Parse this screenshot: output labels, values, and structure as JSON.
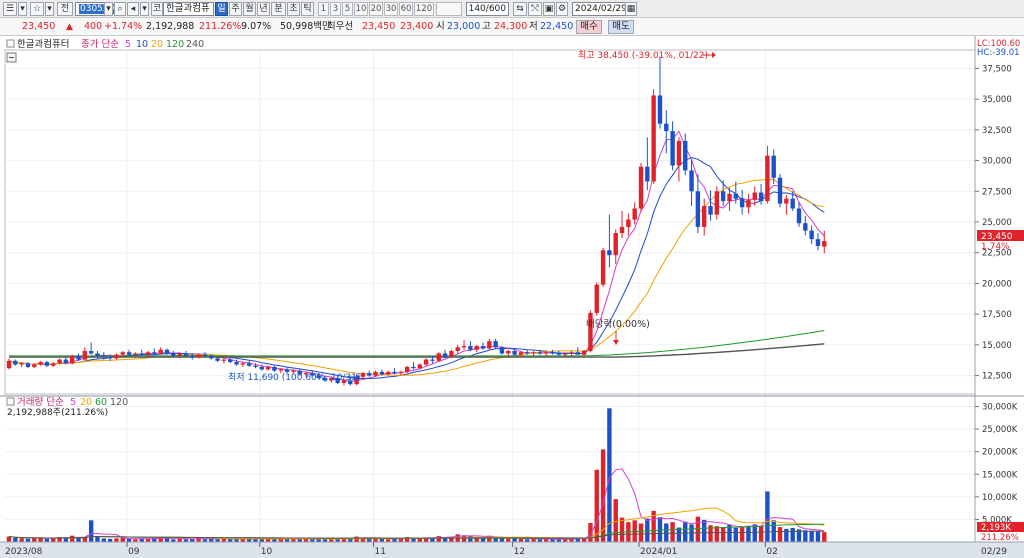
{
  "toolbar": {
    "menu_icon": "menu-icon",
    "star_icon": "star-icon",
    "market_label": "전",
    "stock_code": "030520",
    "stock_name": "한글과컴퓨",
    "prefix_label": "코",
    "periods": [
      "일",
      "주",
      "월",
      "년",
      "분",
      "초",
      "틱"
    ],
    "active_period": "일",
    "numbers": [
      "1",
      "3",
      "5",
      "10",
      "20",
      "30",
      "60",
      "120"
    ],
    "count": "140/600",
    "date": "2024/02/29"
  },
  "quote": {
    "price": "23,450",
    "change": "400",
    "change_rate": "+1.74%",
    "volume": "2,192,988",
    "volume_ratio": "211.26%",
    "turnover": "9.07%",
    "amount": "50,998백만",
    "pref_label": "최우선",
    "ask": "23,450",
    "bid": "23,400",
    "open_label": "시",
    "open": "23,000",
    "high_label": "고",
    "high": "24,300",
    "low_label": "저",
    "low": "22,450",
    "buy_label": "매수",
    "sell_label": "매도"
  },
  "price_panel": {
    "legend_name": "한글과컴퓨터",
    "ma_label": "종가 단순",
    "ma_periods": [
      "5",
      "10",
      "20",
      "120",
      "240"
    ],
    "ma_colors": [
      "#d23fd0",
      "#2248c9",
      "#f0a400",
      "#1e9a2e",
      "#555555"
    ],
    "lc_label": "LC:100.60",
    "hc_label": "HC:-39.01",
    "price_ticks": [
      "37,500",
      "35,000",
      "32,500",
      "30,000",
      "27,500",
      "25,000",
      "22,500",
      "20,000",
      "17,500",
      "15,000",
      "12,500"
    ],
    "current_price_label": "23,450",
    "current_rate_label": "1.74%",
    "high_annotation": "최고 38,450 (-39.01%, 01/22)",
    "low_annotation": "최저 11,690 (100.60%, 10/31)",
    "dividend_annotation": "배당락(0.00%)"
  },
  "volume_panel": {
    "legend_label": "거래량 단순",
    "ma_periods": [
      "5",
      "20",
      "60",
      "120"
    ],
    "ma_colors": [
      "#d23fd0",
      "#f0a400",
      "#1e9a2e",
      "#555555"
    ],
    "volume_info": "2,192,988주(211.26%)",
    "volume_ticks": [
      "30,000K",
      "25,000K",
      "20,000K",
      "15,000K",
      "10,000K",
      "5,000K"
    ],
    "current_volume_label": "2,193K",
    "current_ratio_label": "211.26%"
  },
  "date_axis": [
    "2023/08",
    "09",
    "10",
    "11",
    "12",
    "2024/01",
    "02",
    "02/29"
  ],
  "colors": {
    "up": "#e0232b",
    "down": "#1c52c9",
    "axis_bg": "#dde3ec",
    "active_tab": "#2d69c6"
  },
  "chart_data": {
    "type": "candlestick",
    "price_range": [
      11000,
      39000
    ],
    "volume_range": [
      0,
      31000
    ],
    "candles": [
      [
        13100,
        13900,
        13000,
        13700
      ],
      [
        13700,
        13800,
        13300,
        13400
      ],
      [
        13400,
        13600,
        13200,
        13500
      ],
      [
        13500,
        13600,
        13100,
        13200
      ],
      [
        13200,
        13500,
        13100,
        13400
      ],
      [
        13400,
        13700,
        13300,
        13600
      ],
      [
        13600,
        13700,
        13200,
        13300
      ],
      [
        13300,
        13600,
        13200,
        13500
      ],
      [
        13500,
        13900,
        13400,
        13800
      ],
      [
        13800,
        14000,
        13400,
        13500
      ],
      [
        13500,
        14200,
        13400,
        14100
      ],
      [
        14100,
        14300,
        13700,
        13800
      ],
      [
        13800,
        14800,
        13700,
        14500
      ],
      [
        14500,
        15200,
        14200,
        14300
      ],
      [
        14300,
        14500,
        13900,
        14100
      ],
      [
        14100,
        14400,
        13800,
        14000
      ],
      [
        14000,
        14200,
        13700,
        13900
      ],
      [
        13900,
        14300,
        13800,
        14200
      ],
      [
        14200,
        14500,
        14000,
        14400
      ],
      [
        14400,
        14600,
        14100,
        14200
      ],
      [
        14200,
        14400,
        14000,
        14300
      ],
      [
        14300,
        14600,
        14100,
        14200
      ],
      [
        14200,
        14500,
        14000,
        14400
      ],
      [
        14400,
        14700,
        14200,
        14300
      ],
      [
        14300,
        14800,
        14200,
        14600
      ],
      [
        14600,
        14700,
        14200,
        14300
      ],
      [
        14300,
        14500,
        14000,
        14100
      ],
      [
        14100,
        14400,
        13900,
        14300
      ],
      [
        14300,
        14500,
        14000,
        14100
      ],
      [
        14100,
        14300,
        13800,
        14000
      ],
      [
        14000,
        14300,
        13900,
        14200
      ],
      [
        14200,
        14400,
        14000,
        14100
      ],
      [
        14100,
        14200,
        13800,
        13900
      ],
      [
        13900,
        14100,
        13600,
        13700
      ],
      [
        13700,
        13900,
        13500,
        13800
      ],
      [
        13800,
        14000,
        13500,
        13600
      ],
      [
        13600,
        13800,
        13300,
        13400
      ],
      [
        13400,
        13600,
        13200,
        13500
      ],
      [
        13500,
        13700,
        13200,
        13300
      ],
      [
        13300,
        13500,
        13100,
        13200
      ],
      [
        13200,
        13400,
        12900,
        13000
      ],
      [
        13000,
        13300,
        12900,
        13200
      ],
      [
        13200,
        13300,
        12800,
        12900
      ],
      [
        12900,
        13100,
        12700,
        13000
      ],
      [
        13000,
        13200,
        12700,
        12800
      ],
      [
        12800,
        13000,
        12600,
        12900
      ],
      [
        12900,
        13000,
        12500,
        12600
      ],
      [
        12600,
        12800,
        12400,
        12700
      ],
      [
        12700,
        12900,
        12400,
        12500
      ],
      [
        12500,
        12700,
        12200,
        12300
      ],
      [
        12300,
        12500,
        12000,
        12100
      ],
      [
        12100,
        12400,
        11900,
        12300
      ],
      [
        12300,
        12500,
        11800,
        11900
      ],
      [
        11900,
        12200,
        11700,
        12100
      ],
      [
        12100,
        12400,
        11690,
        11800
      ],
      [
        11800,
        12500,
        11700,
        12400
      ],
      [
        12400,
        12800,
        12300,
        12700
      ],
      [
        12700,
        12900,
        12400,
        12500
      ],
      [
        12500,
        12900,
        12400,
        12800
      ],
      [
        12800,
        13000,
        12500,
        12600
      ],
      [
        12600,
        12900,
        12500,
        12800
      ],
      [
        12800,
        13100,
        12600,
        12700
      ],
      [
        12700,
        12900,
        12500,
        12800
      ],
      [
        12800,
        13300,
        12700,
        13200
      ],
      [
        13200,
        13600,
        13000,
        13100
      ],
      [
        13100,
        13500,
        13000,
        13400
      ],
      [
        13400,
        13900,
        13300,
        13800
      ],
      [
        13800,
        14100,
        13500,
        13700
      ],
      [
        13700,
        14400,
        13600,
        14300
      ],
      [
        14300,
        14600,
        13900,
        14000
      ],
      [
        14000,
        14600,
        13900,
        14500
      ],
      [
        14500,
        15000,
        14300,
        14800
      ],
      [
        14800,
        15400,
        14600,
        14900
      ],
      [
        14900,
        15300,
        14500,
        14600
      ],
      [
        14600,
        15000,
        14400,
        14900
      ],
      [
        14900,
        15200,
        14600,
        14700
      ],
      [
        14700,
        15500,
        14600,
        15300
      ],
      [
        15300,
        15500,
        14700,
        14800
      ],
      [
        14800,
        14900,
        14200,
        14300
      ],
      [
        14300,
        14600,
        14100,
        14500
      ],
      [
        14500,
        14700,
        14100,
        14200
      ],
      [
        14200,
        14500,
        14000,
        14400
      ],
      [
        14400,
        14600,
        14200,
        14300
      ],
      [
        14300,
        14500,
        14100,
        14400
      ],
      [
        14400,
        14600,
        14200,
        14300
      ],
      [
        14300,
        14500,
        14100,
        14400
      ],
      [
        14400,
        14600,
        14200,
        14300
      ],
      [
        14300,
        14500,
        14100,
        14200
      ],
      [
        14200,
        14400,
        14000,
        14300
      ],
      [
        14300,
        14500,
        14100,
        14400
      ],
      [
        14400,
        14800,
        14300,
        14200
      ],
      [
        14200,
        14600,
        14100,
        14500
      ],
      [
        14500,
        17800,
        14400,
        17600
      ],
      [
        17600,
        20100,
        17400,
        19900
      ],
      [
        19900,
        22900,
        19700,
        22700
      ],
      [
        22700,
        25600,
        21300,
        22300
      ],
      [
        22300,
        24400,
        21600,
        24100
      ],
      [
        24100,
        25900,
        23700,
        24600
      ],
      [
        24600,
        25700,
        23900,
        25200
      ],
      [
        25200,
        26600,
        24800,
        26100
      ],
      [
        26100,
        29800,
        25800,
        29500
      ],
      [
        29500,
        31900,
        27600,
        28300
      ],
      [
        28300,
        35800,
        28100,
        35300
      ],
      [
        35300,
        38450,
        32600,
        33000
      ],
      [
        33000,
        34100,
        30600,
        32400
      ],
      [
        32400,
        33200,
        29200,
        29600
      ],
      [
        29600,
        31900,
        28300,
        31600
      ],
      [
        31600,
        32200,
        28800,
        29200
      ],
      [
        29200,
        30100,
        26300,
        27500
      ],
      [
        27500,
        28900,
        24100,
        24600
      ],
      [
        24600,
        26900,
        23900,
        26300
      ],
      [
        26300,
        27600,
        25100,
        25600
      ],
      [
        25600,
        27900,
        25200,
        27500
      ],
      [
        27500,
        28400,
        26300,
        26700
      ],
      [
        26700,
        27800,
        25900,
        27300
      ],
      [
        27300,
        28300,
        26500,
        26900
      ],
      [
        26900,
        27600,
        25600,
        26200
      ],
      [
        26200,
        27300,
        25700,
        26800
      ],
      [
        26800,
        27900,
        26300,
        27400
      ],
      [
        27400,
        28100,
        26400,
        26700
      ],
      [
        26700,
        31200,
        26500,
        30400
      ],
      [
        30400,
        30900,
        28100,
        28600
      ],
      [
        28600,
        28900,
        26200,
        26500
      ],
      [
        26500,
        27200,
        25600,
        26900
      ],
      [
        26900,
        27500,
        25900,
        26100
      ],
      [
        26100,
        26600,
        24600,
        24900
      ],
      [
        24900,
        25500,
        23900,
        24300
      ],
      [
        24300,
        24700,
        23200,
        23600
      ],
      [
        23600,
        24100,
        22700,
        23050
      ],
      [
        23000,
        24300,
        22450,
        23450
      ]
    ],
    "volume_values": [
      1200,
      900,
      800,
      700,
      900,
      1000,
      700,
      800,
      1100,
      900,
      1400,
      900,
      1100,
      4800,
      1200,
      800,
      700,
      800,
      900,
      700,
      600,
      800,
      700,
      900,
      1100,
      800,
      600,
      700,
      600,
      700,
      900,
      600,
      700,
      600,
      800,
      600,
      700,
      600,
      800,
      700,
      600,
      700,
      600,
      800,
      600,
      700,
      600,
      700,
      600,
      700,
      800,
      600,
      700,
      800,
      900,
      1200,
      1000,
      700,
      800,
      700,
      600,
      800,
      700,
      1100,
      900,
      800,
      1000,
      900,
      1300,
      1100,
      1200,
      1700,
      1500,
      1300,
      1000,
      900,
      1400,
      1000,
      900,
      700,
      800,
      700,
      600,
      700,
      600,
      700,
      600,
      700,
      600,
      700,
      900,
      900,
      4200,
      16000,
      20500,
      29600,
      9500,
      5400,
      4400,
      4800,
      4100,
      5200,
      6900,
      5500,
      4100,
      4400,
      3200,
      4500,
      3900,
      5600,
      4900,
      3700,
      3500,
      3300,
      3800,
      3100,
      3400,
      3600,
      3900,
      3500,
      11200,
      4800,
      3300,
      2900,
      3100,
      2800,
      2600,
      2500,
      2400,
      2193
    ],
    "volume_up": [
      true,
      false,
      true,
      false,
      true,
      true,
      false,
      true,
      true,
      false,
      true,
      false,
      true,
      false,
      false,
      false,
      false,
      true,
      true,
      false,
      true,
      false,
      true,
      false,
      true,
      false,
      false,
      true,
      false,
      false,
      true,
      false,
      false,
      false,
      true,
      false,
      false,
      true,
      false,
      false,
      false,
      true,
      false,
      true,
      false,
      true,
      false,
      true,
      false,
      false,
      false,
      true,
      false,
      true,
      false,
      true,
      true,
      false,
      true,
      false,
      true,
      false,
      true,
      true,
      false,
      true,
      true,
      false,
      true,
      false,
      true,
      true,
      true,
      false,
      true,
      false,
      true,
      false,
      false,
      true,
      false,
      true,
      false,
      true,
      false,
      true,
      false,
      false,
      true,
      true,
      false,
      true,
      true,
      true,
      true,
      false,
      true,
      true,
      true,
      true,
      true,
      false,
      true,
      false,
      false,
      true,
      false,
      false,
      false,
      true,
      false,
      true,
      true,
      true,
      false,
      false,
      true,
      false,
      false,
      true,
      false,
      false,
      true,
      false,
      false,
      false,
      false,
      false,
      false,
      true
    ]
  }
}
